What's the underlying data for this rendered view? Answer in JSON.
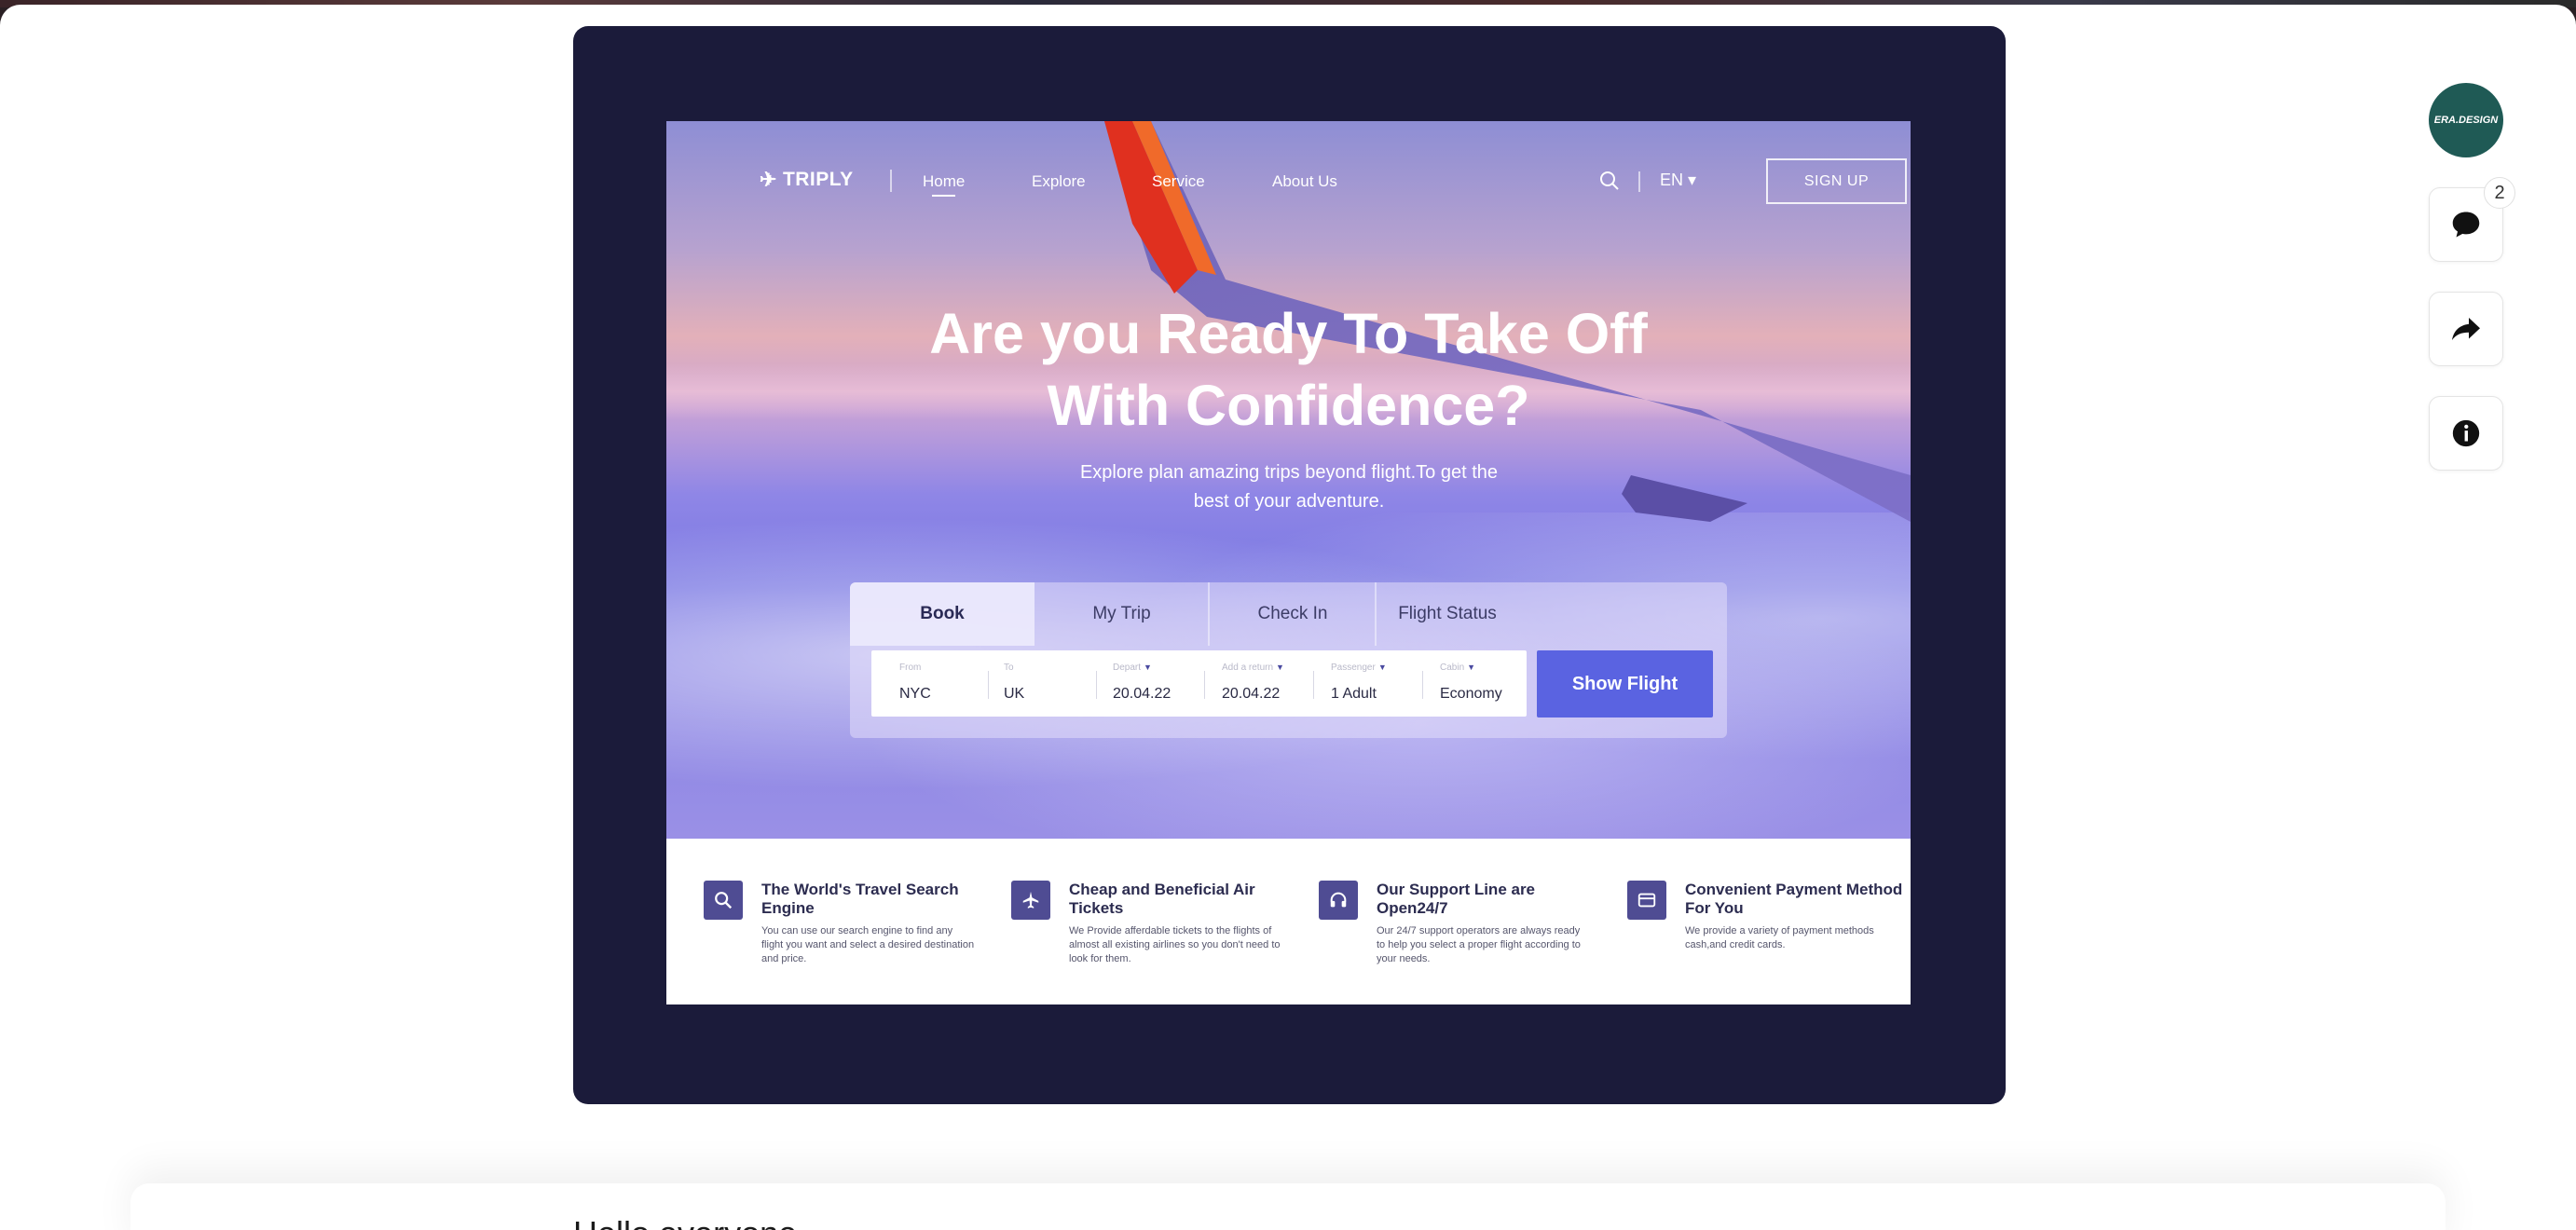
{
  "hero": {
    "logo": "TRIPLY",
    "nav": [
      "Home",
      "Explore",
      "Service",
      "About Us"
    ],
    "lang": "EN ▾",
    "signup": "SIGN UP",
    "headline_line1": "Are you Ready To Take Off",
    "headline_line2": "With Confidence?",
    "subtext": "Explore plan amazing trips beyond flight.To get the best of your adventure."
  },
  "booking": {
    "tabs": [
      "Book",
      "My Trip",
      "Check In",
      "Flight Status"
    ],
    "fields": [
      {
        "label": "From",
        "value": "NYC"
      },
      {
        "label": "To",
        "value": "UK"
      },
      {
        "label": "Depart",
        "value": "20.04.22"
      },
      {
        "label": "Add a return",
        "value": "20.04.22"
      },
      {
        "label": "Passenger",
        "value": "1 Adult"
      },
      {
        "label": "Cabin",
        "value": "Economy"
      }
    ],
    "button": "Show Flight"
  },
  "features": [
    {
      "title": "The World's Travel Search Engine",
      "text": "You can use our search engine to find any flight you want and select a desired destination and price.",
      "icon": "search-icon"
    },
    {
      "title": "Cheap and Beneficial Air Tickets",
      "text": "We Provide afferdable tickets to the flights of almost all existing airlines so you don't need to look for them.",
      "icon": "plane-icon"
    },
    {
      "title": "Our Support Line are Open24/7",
      "text": "Our 24/7 support operators are always ready to help you select a proper flight according to your needs.",
      "icon": "headphones-icon"
    },
    {
      "title": "Convenient Payment Method For You",
      "text": "We provide a variety of payment methods cash,and credit cards.",
      "icon": "card-icon"
    }
  ],
  "sidebar": {
    "avatar_text": "ERA.DESIGN",
    "comment_count": "2",
    "icons": [
      "comment-icon",
      "share-icon",
      "info-icon"
    ]
  },
  "below": {
    "heading": "Hello everyone"
  },
  "colors": {
    "frame": "#1b1b3a",
    "accent": "#5a63e1",
    "feature_icon_bg": "#4f4c93",
    "avatar_bg": "#1f5a55"
  }
}
